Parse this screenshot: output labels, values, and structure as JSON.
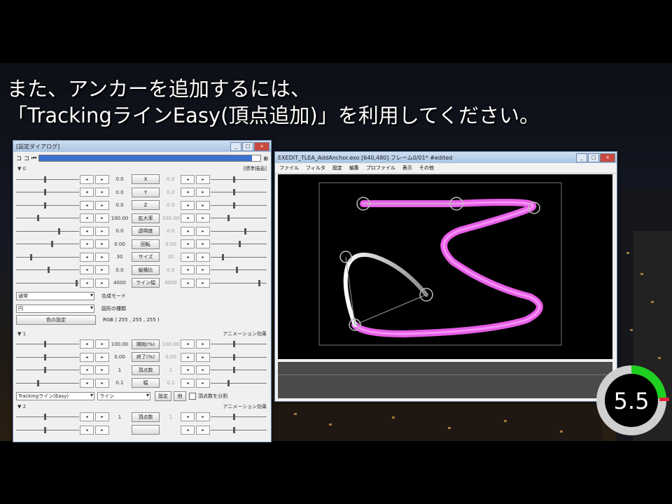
{
  "caption": {
    "line1": "また、アンカーを追加するには、",
    "line2": "「TrackingラインEasy(頂点追加)」を利用してください。"
  },
  "settings_window": {
    "title": "[設定ダイアログ]",
    "toolbar": {
      "left1": "コ",
      "left2": "コ",
      "frame_icon": "⏮",
      "pin_icon": "⊞"
    },
    "section1_label": "▼ 0",
    "section1_right": "[標準描画]",
    "rows": [
      {
        "value": "0.0",
        "button": "X",
        "value2": "0.0"
      },
      {
        "value": "0.0",
        "button": "Y",
        "value2": "0.0"
      },
      {
        "value": "0.0",
        "button": "Z",
        "value2": "0.0"
      },
      {
        "value": "100.00",
        "button": "拡大率",
        "value2": "100.00"
      },
      {
        "value": "0.0",
        "button": "透明度",
        "value2": "0.0"
      },
      {
        "value": "0.00",
        "button": "回転",
        "value2": "0.00"
      },
      {
        "value": "30",
        "button": "サイズ",
        "value2": "30"
      },
      {
        "value": "0.0",
        "button": "縦横比",
        "value2": "0.0"
      },
      {
        "value": "4000",
        "button": "ライン幅",
        "value2": "4000"
      }
    ],
    "blend_mode": "通常",
    "blend_label": "合成モード",
    "shape_type": "円",
    "shape_label": "図形の種類",
    "color_button": "色の設定",
    "color_value": "RGB ( 255 , 255 , 255 )",
    "section2_label": "▼ 1",
    "section2_right": "アニメーション効果",
    "rows2": [
      {
        "value": "100.00",
        "button": "開始(%)",
        "value2": "100.00"
      },
      {
        "value": "0.00",
        "button": "終了(%)",
        "value2": "0.00"
      },
      {
        "value": "1",
        "button": "頂点数",
        "value2": "1"
      },
      {
        "value": "0.1",
        "button": "幅",
        "value2": "0.1"
      }
    ],
    "effect_dropdown": "Trackingライン(Easy)",
    "line_dropdown": "ライン",
    "settings_btn": "設定",
    "small_btn": "他",
    "checkbox_label": "頂点数を分割",
    "section3_label": "▼ 2",
    "section3_right": "アニメーション効果",
    "rows3": [
      {
        "value": "1",
        "button": "頂点数",
        "value2": "1"
      },
      {
        "value": "",
        "button": "",
        "value2": ""
      }
    ]
  },
  "preview_window": {
    "title": "EXEDIT_TLEA_AddAnchor.exo [640,480]  フレーム0/01*  #edited",
    "menu": [
      "ファイル",
      "フィルタ",
      "設定",
      "編集",
      "プロファイル",
      "表示",
      "その他"
    ]
  },
  "timer": {
    "value": "5.5",
    "progress": 0.24,
    "color_ring": "#20d020",
    "color_mark": "#e0203c"
  },
  "colors": {
    "magenta": "#ff66ff",
    "white_line": "#f0f0f0"
  }
}
